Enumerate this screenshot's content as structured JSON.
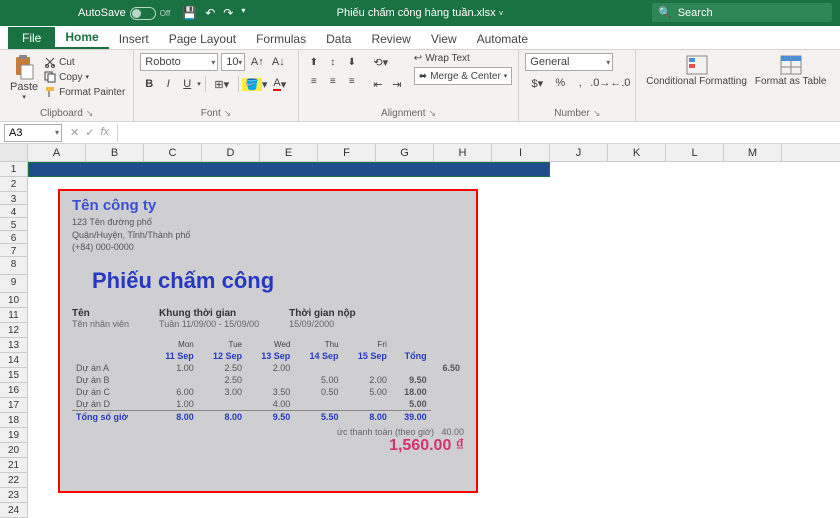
{
  "titlebar": {
    "autosave": "AutoSave",
    "autosave_state": "Off",
    "doc": "Phiếu chấm công hàng tuần.xlsx",
    "search": "Search"
  },
  "tabs": {
    "file": "File",
    "home": "Home",
    "insert": "Insert",
    "page_layout": "Page Layout",
    "formulas": "Formulas",
    "data": "Data",
    "review": "Review",
    "view": "View",
    "automate": "Automate"
  },
  "ribbon": {
    "clipboard": {
      "paste": "Paste",
      "cut": "Cut",
      "copy": "Copy",
      "painter": "Format Painter",
      "label": "Clipboard"
    },
    "font": {
      "name": "Roboto",
      "size": "10",
      "label": "Font"
    },
    "alignment": {
      "wrap": "Wrap Text",
      "merge": "Merge & Center",
      "label": "Alignment"
    },
    "number": {
      "format": "General",
      "label": "Number"
    },
    "styles": {
      "cond": "Conditional Formatting",
      "fmt_as": "Format as Table"
    }
  },
  "formula_bar": {
    "cell": "A3"
  },
  "columns": [
    "A",
    "B",
    "C",
    "D",
    "E",
    "F",
    "G",
    "H",
    "I",
    "J",
    "K",
    "L",
    "M"
  ],
  "rows_start": 1,
  "rows_end": 24,
  "timesheet": {
    "company": "Tên công ty",
    "addr1": "123 Tên đường phố",
    "addr2": "Quận/Huyện, Tỉnh/Thành phố",
    "phone": "(+84) 000-0000",
    "title": "Phiếu chấm công",
    "meta": {
      "name_lbl": "Tên",
      "name_val": "Tên nhân viên",
      "period_lbl": "Khung thời gian",
      "period_val": "Tuần 11/09/00 - 15/09/00",
      "submit_lbl": "Thời gian nộp",
      "submit_val": "15/09/2000"
    },
    "days_short": [
      "Mon",
      "Tue",
      "Wed",
      "Thu",
      "Fri"
    ],
    "days_date": [
      "11 Sep",
      "12 Sep",
      "13 Sep",
      "14 Sep",
      "15 Sep"
    ],
    "total_lbl": "Tổng",
    "projects": [
      {
        "name": "Dự án A",
        "v": [
          "1.00",
          "2.50",
          "2.00",
          "",
          "",
          ""
        ],
        "t": "6.50"
      },
      {
        "name": "Dự án B",
        "v": [
          "",
          "2.50",
          "",
          "5.00",
          "2.00"
        ],
        "t": "9.50"
      },
      {
        "name": "Dự án C",
        "v": [
          "6.00",
          "3.00",
          "3.50",
          "0.50",
          "5.00"
        ],
        "t": "18.00"
      },
      {
        "name": "Dự án D",
        "v": [
          "1.00",
          "",
          "4.00",
          "",
          ""
        ],
        "t": "5.00"
      }
    ],
    "total_row_lbl": "Tổng số giờ",
    "totals": [
      "8.00",
      "8.00",
      "9.50",
      "5.50",
      "8.00"
    ],
    "grand_total": "39.00",
    "pay_lbl": "ức thanh toán (theo giờ)",
    "pay_rate": "40.00",
    "pay_amt": "1,560.00 ₫"
  }
}
